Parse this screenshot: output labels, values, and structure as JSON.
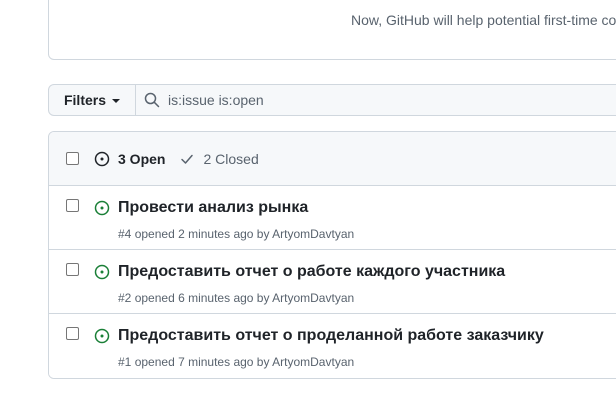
{
  "onboarding": {
    "text": "Now, GitHub will help potential first-time co"
  },
  "filter_bar": {
    "filters_label": "Filters",
    "search_value": "is:issue is:open"
  },
  "list_header": {
    "open_label": "3 Open",
    "closed_label": "2 Closed"
  },
  "colors": {
    "open_green": "#1a7f37",
    "border": "#d0d7de",
    "muted": "#59636e"
  },
  "issues": [
    {
      "title": "Провести анализ рынка",
      "number": "#4",
      "opened": "opened 2 minutes ago by",
      "author": "ArtyomDavtyan"
    },
    {
      "title": "Предоставить отчет о работе каждого участника",
      "number": "#2",
      "opened": "opened 6 minutes ago by",
      "author": "ArtyomDavtyan"
    },
    {
      "title": "Предоставить отчет о проделанной работе заказчику",
      "number": "#1",
      "opened": "opened 7 minutes ago by",
      "author": "ArtyomDavtyan"
    }
  ]
}
